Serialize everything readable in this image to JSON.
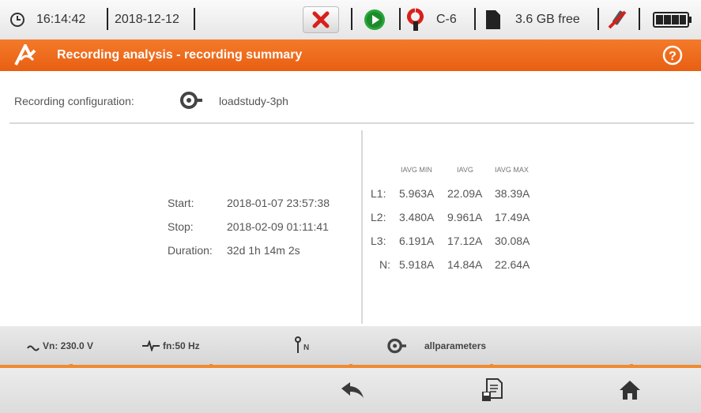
{
  "status": {
    "time": "16:14:42",
    "date": "2018-12-12",
    "clamp": "C-6",
    "storage": "3.6 GB free"
  },
  "header": {
    "title": "Recording analysis - recording summary"
  },
  "config": {
    "label": "Recording configuration:",
    "name": "loadstudy-3ph"
  },
  "times": {
    "start_label": "Start:",
    "start": "2018-01-07 23:57:38",
    "stop_label": "Stop:",
    "stop": "2018-02-09 01:11:41",
    "duration_label": "Duration:",
    "duration": "32d 1h 14m 2s"
  },
  "table": {
    "headers": [
      "IAVG MIN",
      "IAVG",
      "IAVG MAX"
    ],
    "rows": [
      {
        "label": "L1:",
        "min": "5.963A",
        "avg": "22.09A",
        "max": "38.39A"
      },
      {
        "label": "L2:",
        "min": "3.480A",
        "avg": "9.961A",
        "max": "17.49A"
      },
      {
        "label": "L3:",
        "min": "6.191A",
        "avg": "17.12A",
        "max": "30.08A"
      },
      {
        "label": "N:",
        "min": "5.918A",
        "avg": "14.84A",
        "max": "22.64A"
      }
    ]
  },
  "footer": {
    "voltage": "Vn: 230.0 V",
    "frequency": "fn:50 Hz",
    "neutral": "N",
    "profile": "allparameters"
  },
  "colors": {
    "accent": "#ee6a1c",
    "status_bar": "#eeeeee",
    "close_red": "#d8201a",
    "play_green": "#2aa53a"
  }
}
